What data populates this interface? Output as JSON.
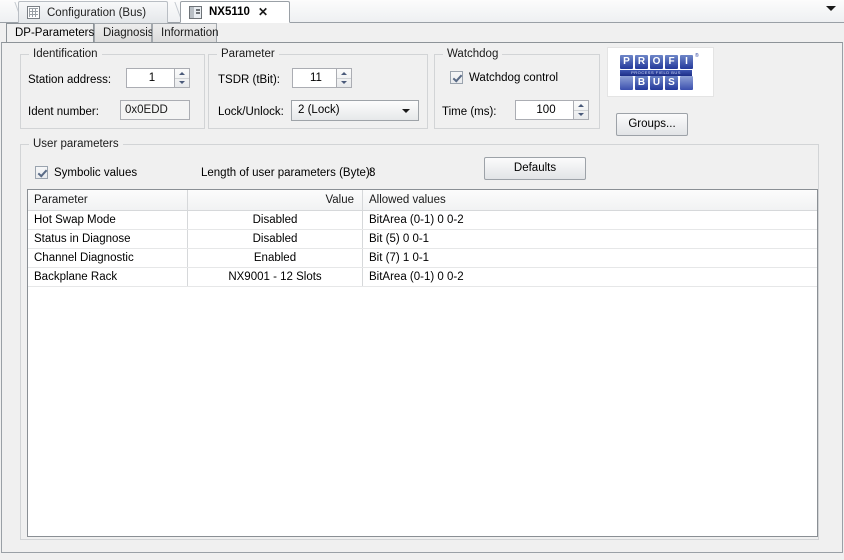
{
  "document_tabs": {
    "tabs": [
      {
        "label": "Configuration (Bus)",
        "icon": "grid-icon",
        "active": false,
        "closable": false
      },
      {
        "label": "NX5110",
        "icon": "module-icon",
        "active": true,
        "closable": true,
        "close_glyph": "✕"
      }
    ],
    "overflow_icon": "chevron-down-icon"
  },
  "page_tabs": [
    {
      "label": "DP-Parameters",
      "active": true
    },
    {
      "label": "Diagnosis",
      "active": false
    },
    {
      "label": "Information",
      "active": false
    }
  ],
  "identification": {
    "title": "Identification",
    "station_address_label": "Station address:",
    "station_address_value": "1",
    "ident_number_label": "Ident number:",
    "ident_number_value": "0x0EDD"
  },
  "parameter": {
    "title": "Parameter",
    "tsdr_label": "TSDR (tBit):",
    "tsdr_value": "11",
    "lock_label": "Lock/Unlock:",
    "lock_value": "2 (Lock)"
  },
  "watchdog": {
    "title": "Watchdog",
    "control_label": "Watchdog control",
    "control_checked": true,
    "time_label": "Time (ms):",
    "time_value": "100"
  },
  "logo": {
    "top_letters": [
      "P",
      "R",
      "O",
      "F",
      "I"
    ],
    "bottom_letters": [
      "",
      "B",
      "U",
      "S",
      ""
    ],
    "bar_text": "PROCESS FIELD BUS",
    "registered_mark": "®",
    "brand_color": "#24399b"
  },
  "buttons": {
    "groups_label": "Groups...",
    "defaults_label": "Defaults"
  },
  "user_parameters": {
    "title": "User parameters",
    "symbolic_values_label": "Symbolic values",
    "symbolic_values_checked": true,
    "length_label": "Length of user parameters (Byte):",
    "length_value": "8"
  },
  "table": {
    "columns": [
      "Parameter",
      "Value",
      "Allowed values"
    ],
    "rows": [
      {
        "parameter": "Hot Swap Mode",
        "value": "Disabled",
        "allowed": "BitArea (0-1) 0 0-2"
      },
      {
        "parameter": "Status in Diagnose",
        "value": "Disabled",
        "allowed": "Bit (5) 0 0-1"
      },
      {
        "parameter": "Channel Diagnostic",
        "value": "Enabled",
        "allowed": "Bit (7) 1 0-1"
      },
      {
        "parameter": "Backplane Rack",
        "value": "NX9001 - 12 Slots",
        "allowed": "BitArea (0-1) 0 0-2"
      }
    ]
  }
}
